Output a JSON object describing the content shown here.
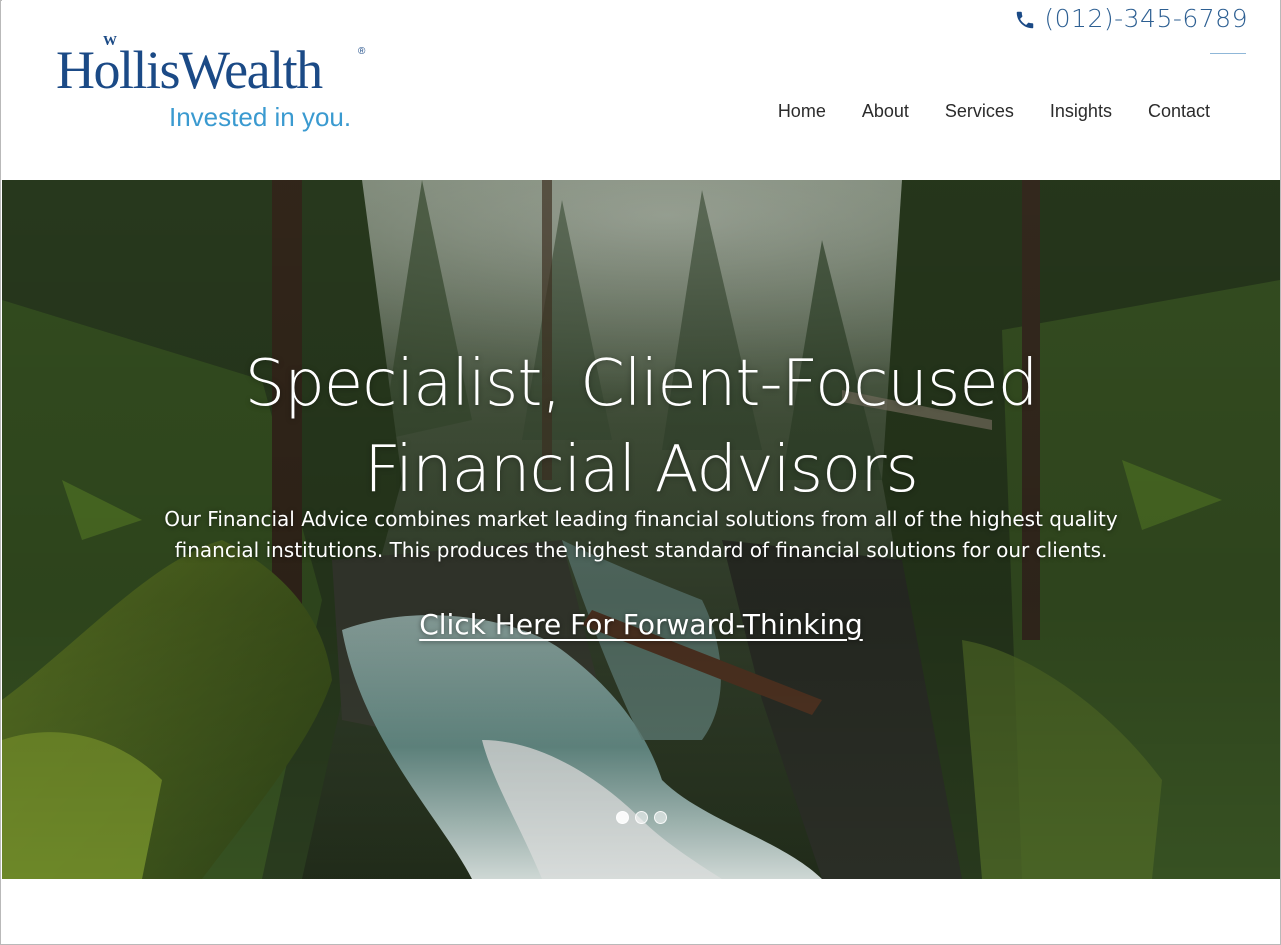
{
  "brand": {
    "wordmark": "HollisWealth",
    "w_mark": "W",
    "registered": "®",
    "tagline": "Invested in you.",
    "primary_color": "#1b4a86",
    "accent_color": "#3a9ad0"
  },
  "header": {
    "phone_icon": "phone-icon",
    "phone": "(012)-345-6789",
    "nav": [
      {
        "label": "Home"
      },
      {
        "label": "About"
      },
      {
        "label": "Services"
      },
      {
        "label": "Insights"
      },
      {
        "label": "Contact"
      }
    ]
  },
  "hero": {
    "title_line1": "Specialist, Client-Focused",
    "title_line2": "Financial Advisors",
    "subtitle": "Our Financial Advice combines market leading financial solutions from all of the highest quality financial institutions. This produces the highest standard of financial solutions for our clients.",
    "cta": "Click Here For Forward-Thinking",
    "slides": 3,
    "active_slide": 1
  }
}
